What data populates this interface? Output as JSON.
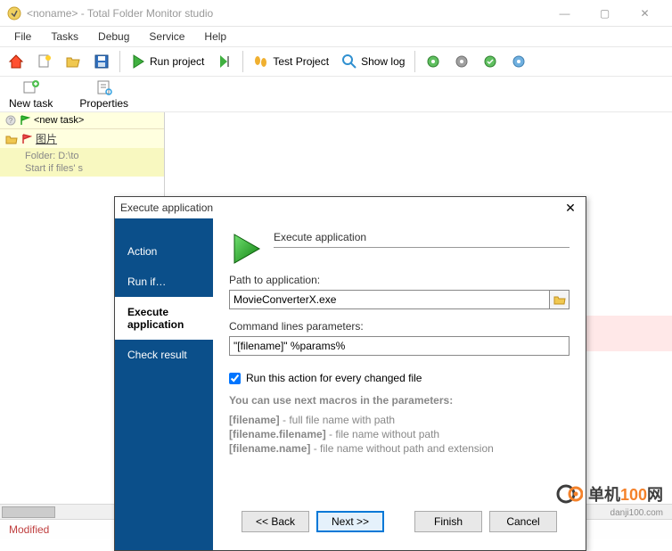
{
  "window": {
    "title": "<noname> - Total Folder Monitor studio",
    "minimize": "—",
    "maximize": "▢",
    "close": "✕"
  },
  "menu": {
    "file": "File",
    "tasks": "Tasks",
    "debug": "Debug",
    "service": "Service",
    "help": "Help"
  },
  "toolbar": {
    "run_project": "Run project",
    "test_project": "Test Project",
    "show_log": "Show log"
  },
  "toolbar2": {
    "new_task": "New task",
    "properties": "Properties"
  },
  "taskpane": {
    "tab_label": "<new task>",
    "detail_line1": "Folder: D:\\to",
    "detail_line2": "Start if files' s"
  },
  "statusbar": {
    "modified": "Modified"
  },
  "dialog": {
    "title": "Execute application",
    "close": "✕",
    "steps": {
      "action": "Action",
      "run_if": "Run if…",
      "execute": "Execute application",
      "check": "Check result"
    },
    "header": "Execute application",
    "path_label": "Path to application:",
    "path_value": "MovieConverterX.exe",
    "cmd_label": "Command lines parameters:",
    "cmd_value": "\"[filename]\" %params%",
    "checkbox_label": "Run this action for every changed file",
    "checkbox_checked": true,
    "macros_head": "You can use next macros in the parameters:",
    "macro1_key": "[filename]",
    "macro1_desc": " - full file name with path",
    "macro2_key": "[filename.filename]",
    "macro2_desc": " - file name without path",
    "macro3_key": "[filename.name]",
    "macro3_desc": " - file name without path and extension",
    "buttons": {
      "back": "<< Back",
      "next": "Next >>",
      "finish": "Finish",
      "cancel": "Cancel"
    }
  },
  "watermark": {
    "brand_a": "单机",
    "brand_b": "100",
    "brand_c": "网",
    "url": "danji100.com"
  }
}
